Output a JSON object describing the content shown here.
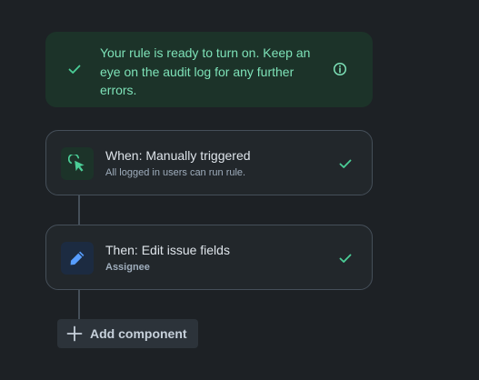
{
  "banner": {
    "message": "Your rule is ready to turn on. Keep an eye on the audit log for any further errors.",
    "icons": [
      "check-icon",
      "info-icon"
    ],
    "color": "#7ee2b8"
  },
  "components": {
    "trigger": {
      "title": "When: Manually triggered",
      "subtitle": "All logged in users can run rule.",
      "icon": "cursor-click-icon",
      "status": "check-icon"
    },
    "action": {
      "title": "Then: Edit issue fields",
      "subtitle": "Assignee",
      "icon": "pencil-icon",
      "status": "check-icon"
    }
  },
  "add_component": {
    "label": "Add component",
    "icon": "plus-icon"
  },
  "colors": {
    "background": "#1d2125",
    "success": "#4bce97",
    "info_blue": "#579dff"
  }
}
